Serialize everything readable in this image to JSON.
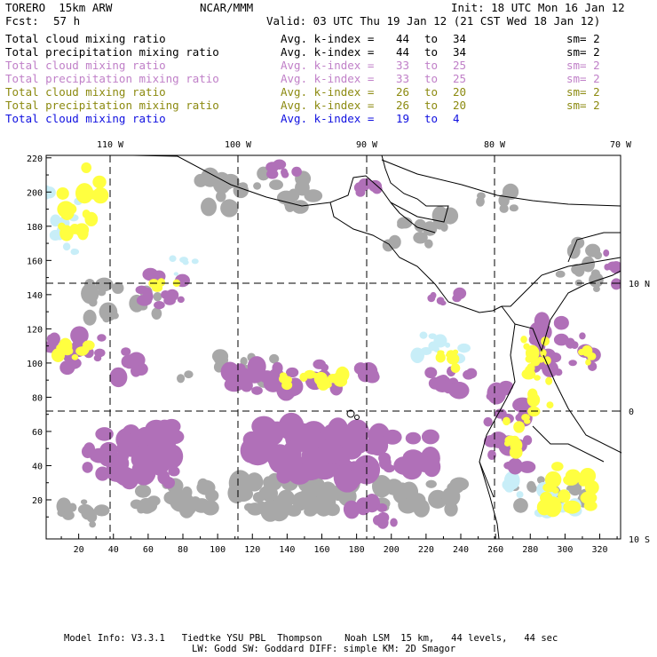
{
  "header": {
    "model": "TORERO  15km ARW",
    "org": "NCAR/MMM",
    "init": "Init: 18 UTC Mon 16 Jan 12",
    "fcst_label": "Fcst:",
    "fcst_value": "57 h",
    "valid": "Valid: 03 UTC Thu 19 Jan 12 (21 CST Wed 18 Jan 12)"
  },
  "legend": [
    {
      "field": "Total cloud mixing ratio",
      "k": "Avg. k-index =",
      "from": "44",
      "to": "to",
      "to_val": "34",
      "sm": "sm= 2",
      "color": "#000000"
    },
    {
      "field": "Total precipitation mixing ratio",
      "k": "Avg. k-index =",
      "from": "44",
      "to": "to",
      "to_val": "34",
      "sm": "sm= 2",
      "color": "#000000"
    },
    {
      "field": "Total cloud mixing ratio",
      "k": "Avg. k-index =",
      "from": "33",
      "to": "to",
      "to_val": "25",
      "sm": "sm= 2",
      "color": "#c080c8"
    },
    {
      "field": "Total precipitation mixing ratio",
      "k": "Avg. k-index =",
      "from": "33",
      "to": "to",
      "to_val": "25",
      "sm": "sm= 2",
      "color": "#c080c8"
    },
    {
      "field": "Total cloud mixing ratio",
      "k": "Avg. k-index =",
      "from": "26",
      "to": "to",
      "to_val": "20",
      "sm": "sm= 2",
      "color": "#8c8a10"
    },
    {
      "field": "Total precipitation mixing ratio",
      "k": "Avg. k-index =",
      "from": "26",
      "to": "to",
      "to_val": "20",
      "sm": "sm= 2",
      "color": "#8c8a10"
    },
    {
      "field": "Total cloud mixing ratio",
      "k": "Avg. k-index =",
      "from": "19",
      "to": "to",
      "to_val": "4",
      "sm": "",
      "color": "#1010e0"
    }
  ],
  "map": {
    "lon_labels": [
      "110 W",
      "100 W",
      "90 W",
      "80 W",
      "70 W"
    ],
    "lat_labels": [
      "10 N",
      "0",
      "10 S"
    ],
    "x_ticks": [
      "20",
      "40",
      "60",
      "80",
      "100",
      "120",
      "140",
      "160",
      "180",
      "200",
      "220",
      "240",
      "260",
      "280",
      "300",
      "320"
    ],
    "y_ticks": [
      "20",
      "40",
      "60",
      "80",
      "100",
      "120",
      "140",
      "160",
      "180",
      "200",
      "220"
    ],
    "colors": {
      "gray": "#a8a8a8",
      "purple": "#b070b8",
      "yellow": "#ffff40",
      "lightblue": "#c8eef8",
      "coast": "#000000"
    }
  },
  "footer": {
    "line1": "Model Info: V3.3.1   Tiedtke YSU PBL  Thompson    Noah LSM  15 km,   44 levels,   44 sec",
    "line2": "LW: Godd SW: Goddard DIFF: simple KM: 2D Smagor"
  }
}
